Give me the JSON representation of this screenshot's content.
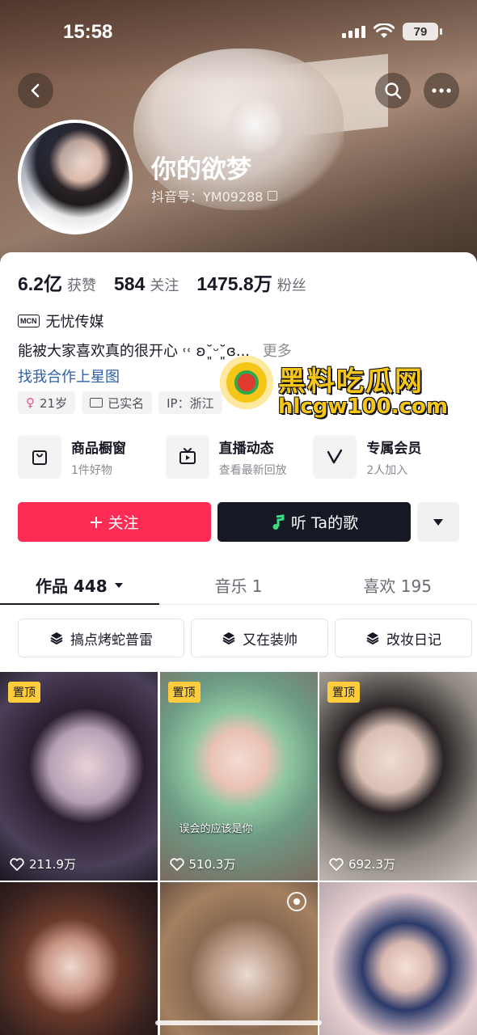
{
  "status_bar": {
    "time": "15:58",
    "battery": "79"
  },
  "profile": {
    "nickname": "你的欲梦",
    "account_id": "抖音号：YM09288"
  },
  "stats": [
    {
      "value": "6.2亿",
      "label": "获赞"
    },
    {
      "value": "584",
      "label": "关注"
    },
    {
      "value": "1475.8万",
      "label": "粉丝"
    }
  ],
  "mcn": {
    "badge": "MCN",
    "name": "无忧传媒"
  },
  "bio": {
    "text": "能被大家喜欢真的很开心 ˓˓ ʚ˘͈ᵕ˘͈ɞ...",
    "more": "更多",
    "link": "找我合作上星图"
  },
  "tags": {
    "age_symbol": "♀",
    "age": "21岁",
    "verified": "已实名",
    "ip": "IP：浙江"
  },
  "features": [
    {
      "icon": "shop-bag-icon",
      "title": "商品橱窗",
      "sub": "1件好物"
    },
    {
      "icon": "tv-icon",
      "title": "直播动态",
      "sub": "查看最新回放"
    },
    {
      "icon": "v-member-icon",
      "title": "专属会员",
      "sub": "2人加入"
    }
  ],
  "actions": {
    "follow": "关注",
    "listen": "听 Ta的歌"
  },
  "tabs": [
    {
      "label": "作品 448",
      "active": true
    },
    {
      "label": "音乐 1",
      "active": false
    },
    {
      "label": "喜欢 195",
      "active": false
    }
  ],
  "collections": [
    "搞点烤蛇普雷",
    "又在装帅",
    "改妆日记"
  ],
  "videos": [
    {
      "pinned": "置顶",
      "likes": "211.9万"
    },
    {
      "pinned": "置顶",
      "likes": "510.3万",
      "caption": "误会的应该是你"
    },
    {
      "pinned": "置顶",
      "likes": "692.3万"
    },
    {},
    {},
    {}
  ],
  "watermark": {
    "title": "黑料吃瓜网",
    "url": "hlcgw100.com"
  },
  "colors": {
    "accent": "#fe2c55",
    "dark_button": "#161823",
    "pin": "#fecc3d",
    "link": "#2d5fa8"
  }
}
